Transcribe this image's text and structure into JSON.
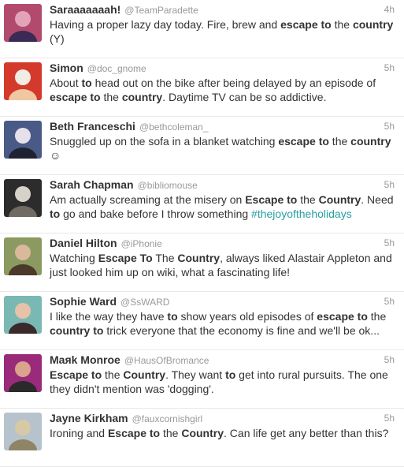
{
  "tweets": [
    {
      "name": "Saraaaaaaah!",
      "handle": "@TeamParadette",
      "time": "4h",
      "avatar_colors": [
        "#b24a6e",
        "#e3a3b8",
        "#3a2a55"
      ],
      "segments": [
        {
          "t": "Having a proper lazy day today. Fire, brew and "
        },
        {
          "t": "escape to",
          "b": true
        },
        {
          "t": " the "
        },
        {
          "t": "country",
          "b": true
        },
        {
          "t": " (Y)"
        }
      ]
    },
    {
      "name": "Simon",
      "handle": "@doc_gnome",
      "time": "5h",
      "avatar_colors": [
        "#d33a2c",
        "#f1ece4",
        "#f0c7a0"
      ],
      "segments": [
        {
          "t": "About "
        },
        {
          "t": "to",
          "b": true
        },
        {
          "t": " head out on the bike after being delayed by an episode of "
        },
        {
          "t": "escape to",
          "b": true
        },
        {
          "t": " the "
        },
        {
          "t": "country",
          "b": true
        },
        {
          "t": ". Daytime TV can be so addictive."
        }
      ]
    },
    {
      "name": "Beth Franceschi",
      "handle": "@bethcoleman_",
      "time": "5h",
      "avatar_colors": [
        "#4a5a86",
        "#e5e0ea",
        "#1f2233"
      ],
      "segments": [
        {
          "t": "Snuggled up on the sofa in a blanket watching "
        },
        {
          "t": "escape to",
          "b": true
        },
        {
          "t": " the "
        },
        {
          "t": "country",
          "b": true
        },
        {
          "t": " ☺"
        }
      ]
    },
    {
      "name": "Sarah Chapman",
      "handle": "@bibliomouse",
      "time": "5h",
      "avatar_colors": [
        "#2c2c2c",
        "#d7d2c9",
        "#6f6a63"
      ],
      "segments": [
        {
          "t": "Am actually screaming at the misery on "
        },
        {
          "t": "Escape to",
          "b": true
        },
        {
          "t": " the "
        },
        {
          "t": "Country",
          "b": true
        },
        {
          "t": ". Need "
        },
        {
          "t": "to",
          "b": true
        },
        {
          "t": " go and bake before I throw something "
        },
        {
          "t": "#thejoyoftheholidays",
          "h": true
        }
      ]
    },
    {
      "name": "Daniel Hilton",
      "handle": "@iPhonie",
      "time": "5h",
      "avatar_colors": [
        "#8a9a60",
        "#d9b99a",
        "#4a3a2a"
      ],
      "segments": [
        {
          "t": "Watching "
        },
        {
          "t": "Escape To",
          "b": true
        },
        {
          "t": " The "
        },
        {
          "t": "Country",
          "b": true
        },
        {
          "t": ", always liked Alastair Appleton and just looked him up on wiki, what a fascinating life!"
        }
      ]
    },
    {
      "name": "Sophie Ward",
      "handle": "@SsWARD",
      "time": "5h",
      "avatar_colors": [
        "#7ab8b4",
        "#e7c1a8",
        "#3a2a2a"
      ],
      "segments": [
        {
          "t": "I like the way they have "
        },
        {
          "t": "to",
          "b": true
        },
        {
          "t": " show years old episodes of "
        },
        {
          "t": "escape to",
          "b": true
        },
        {
          "t": " the "
        },
        {
          "t": "country to",
          "b": true
        },
        {
          "t": " trick everyone that the economy is fine and we'll be ok..."
        }
      ]
    },
    {
      "name": "Maяk Monroe",
      "handle": "@HausOfBromance",
      "time": "5h",
      "avatar_colors": [
        "#9a2a7a",
        "#d9a38c",
        "#2a2a2a"
      ],
      "segments": [
        {
          "t": "Escape to",
          "b": true
        },
        {
          "t": " the "
        },
        {
          "t": "Country",
          "b": true
        },
        {
          "t": ". They want "
        },
        {
          "t": "to",
          "b": true
        },
        {
          "t": " get into rural pursuits. The one they didn't mention was 'dogging'."
        }
      ]
    },
    {
      "name": "Jayne Kirkham",
      "handle": "@fauxcornishgirl",
      "time": "5h",
      "avatar_colors": [
        "#b7c3cc",
        "#d8c9a6",
        "#8f8466"
      ],
      "segments": [
        {
          "t": "Ironing and "
        },
        {
          "t": "Escape to",
          "b": true
        },
        {
          "t": " the "
        },
        {
          "t": "Country",
          "b": true
        },
        {
          "t": ". Can life get any better than this?"
        }
      ]
    }
  ]
}
